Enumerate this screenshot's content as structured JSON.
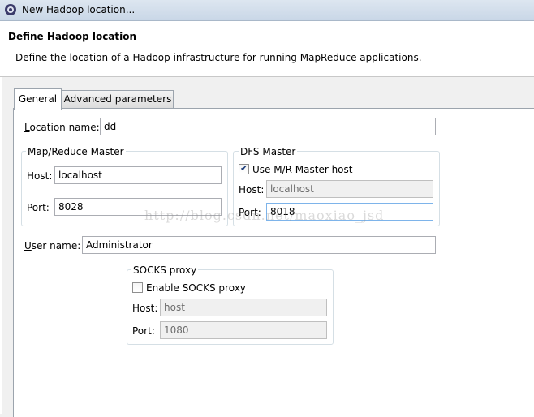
{
  "window": {
    "title": "New Hadoop location..."
  },
  "header": {
    "title": "Define Hadoop location",
    "description": "Define the location of a Hadoop infrastructure for running MapReduce applications."
  },
  "tabs": [
    {
      "label": "General",
      "selected": true
    },
    {
      "label": "Advanced parameters",
      "selected": false
    }
  ],
  "general": {
    "location_name": {
      "label_mnemonic": "L",
      "label_rest": "ocation name:",
      "value": "dd"
    },
    "mapreduce_master": {
      "title": "Map/Reduce Master",
      "host_label": "Host:",
      "host_value": "localhost",
      "port_label": "Port:",
      "port_value": "8028"
    },
    "dfs_master": {
      "title": "DFS Master",
      "use_mr_host_label": "Use M/R Master host",
      "use_mr_host_checked": true,
      "host_label": "Host:",
      "host_value": "localhost",
      "port_label": "Port:",
      "port_value": "8018"
    },
    "user_name": {
      "label_mnemonic": "U",
      "label_rest": "ser name:",
      "value": "Administrator"
    },
    "socks_proxy": {
      "title": "SOCKS proxy",
      "enable_label": "Enable SOCKS proxy",
      "enable_checked": false,
      "host_label": "Host:",
      "host_value": "host",
      "port_label": "Port:",
      "port_value": "1080"
    }
  },
  "watermark": "http://blog.csdn.net/maoxiao_jsd",
  "colors": {
    "titlebar": "#c9d7e7",
    "panel": "#ffffff",
    "dialog_bg": "#f0f0f0",
    "checkbox_check": "#1c3d7a"
  }
}
